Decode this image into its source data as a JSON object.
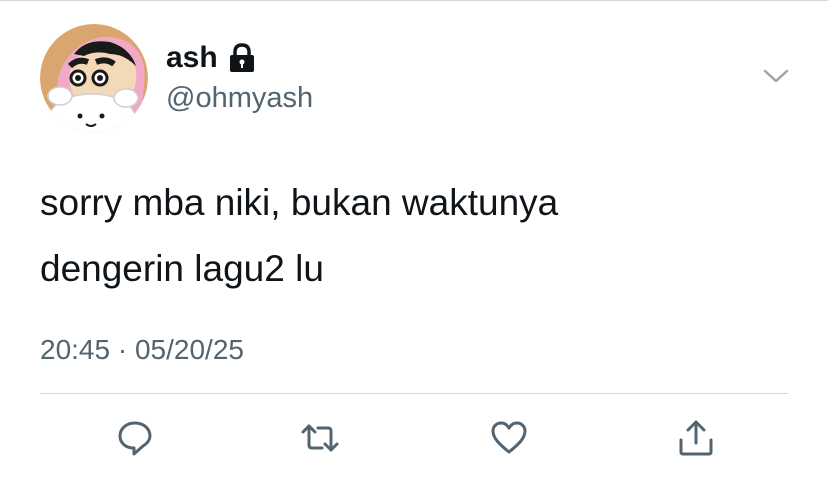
{
  "tweet": {
    "author": {
      "display_name": "ash",
      "handle": "@ohmyash",
      "protected_icon": "lock-icon",
      "avatar": "avatar-pink-hood-cartoon"
    },
    "text_lines": [
      "sorry mba niki, bukan waktunya",
      "dengerin lagu2 lu"
    ],
    "time": "20:45",
    "separator": "·",
    "date": "05/20/25",
    "menu_icon": "chevron-down-icon",
    "actions": [
      {
        "name": "reply",
        "icon": "reply-icon"
      },
      {
        "name": "retweet",
        "icon": "retweet-icon"
      },
      {
        "name": "like",
        "icon": "heart-icon"
      },
      {
        "name": "share",
        "icon": "share-icon"
      }
    ]
  },
  "colors": {
    "text_primary": "#0f1419",
    "text_secondary": "#536471",
    "icon": "#536471",
    "divider": "#cfd9de",
    "background": "#ffffff"
  }
}
